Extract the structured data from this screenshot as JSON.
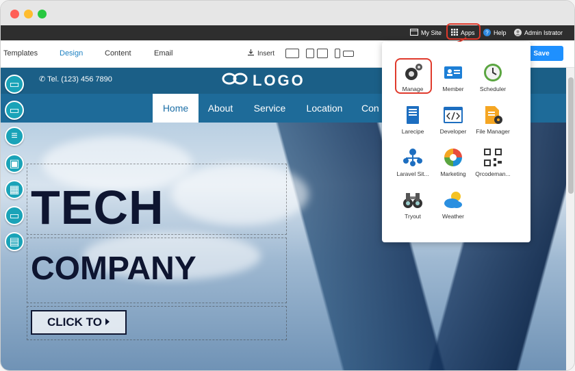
{
  "topbar": {
    "my_site": "My Site",
    "apps": "Apps",
    "help": "Help",
    "user": "Admin Istrator"
  },
  "editor": {
    "tabs": [
      "Templates",
      "Design",
      "Content",
      "Email"
    ],
    "active_tab": "Design",
    "insert": "Insert",
    "save": "Save"
  },
  "site": {
    "phone": "Tel. (123) 456 7890",
    "logo": "LOGO",
    "nav": [
      "Home",
      "About",
      "Service",
      "Location",
      "Con"
    ],
    "hero_title": "TECH",
    "hero_sub": "COMPANY",
    "cta": "CLICK TO"
  },
  "apps_menu": [
    {
      "label": "Manage",
      "icon": "gears-icon"
    },
    {
      "label": "Member",
      "icon": "member-card-icon"
    },
    {
      "label": "Scheduler",
      "icon": "clock-icon"
    },
    {
      "label": "Larecipe",
      "icon": "book-icon"
    },
    {
      "label": "Developer",
      "icon": "code-icon"
    },
    {
      "label": "File Manager",
      "icon": "file-gear-icon"
    },
    {
      "label": "Laravel Sit...",
      "icon": "sitemap-icon"
    },
    {
      "label": "Marketing",
      "icon": "pie-chart-icon"
    },
    {
      "label": "Qrcodeman...",
      "icon": "qrcode-icon"
    },
    {
      "label": "Tryout",
      "icon": "binoculars-icon"
    },
    {
      "label": "Weather",
      "icon": "cloud-sun-icon"
    }
  ],
  "colors": {
    "header": "#1b5f87",
    "nav": "#1e6b99",
    "accent": "#1e90ff",
    "tool": "#1aa3b8",
    "highlight": "#e0392b"
  }
}
